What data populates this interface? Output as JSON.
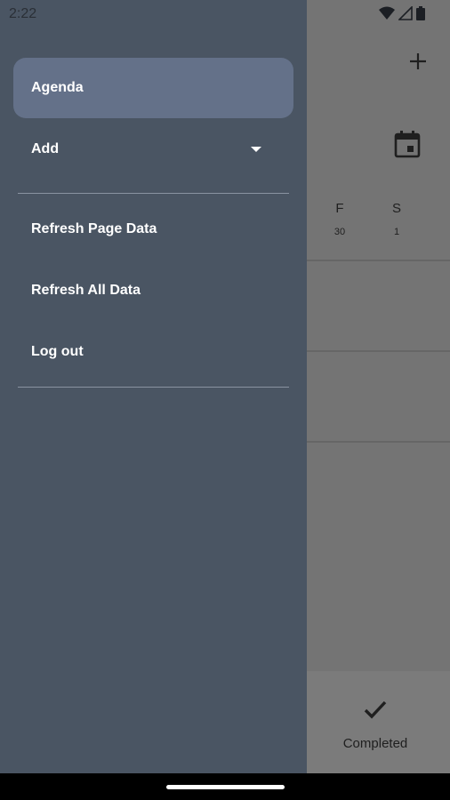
{
  "status_bar": {
    "time": "2:22"
  },
  "drawer": {
    "items": [
      {
        "label": "Agenda"
      },
      {
        "label": "Add"
      },
      {
        "label": "Refresh Page Data"
      },
      {
        "label": "Refresh All Data"
      },
      {
        "label": "Log out"
      }
    ]
  },
  "background": {
    "days": [
      {
        "letter": "F",
        "num": "30"
      },
      {
        "letter": "S",
        "num": "1"
      }
    ],
    "bottom_tab": {
      "label": "Completed",
      "icon": "check-icon"
    }
  },
  "colors": {
    "drawer_bg": "#4a5563",
    "active_item_bg": "#647189",
    "scrim": "#747474"
  }
}
